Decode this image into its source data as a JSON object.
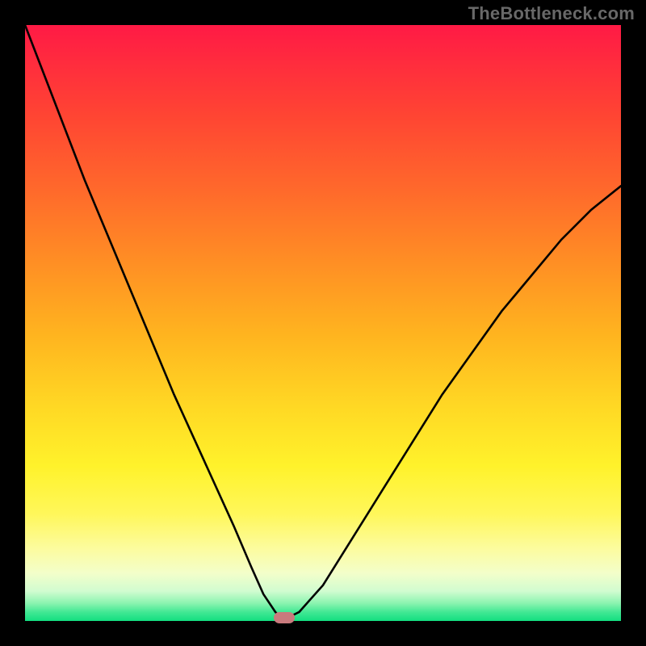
{
  "watermark": "TheBottleneck.com",
  "chart_data": {
    "type": "line",
    "title": "",
    "xlabel": "",
    "ylabel": "",
    "xlim": [
      0,
      100
    ],
    "ylim": [
      0,
      100
    ],
    "series": [
      {
        "name": "bottleneck-curve",
        "x": [
          0,
          5,
          10,
          15,
          20,
          25,
          30,
          35,
          38,
          40,
          42,
          43,
          44,
          46,
          50,
          55,
          60,
          65,
          70,
          75,
          80,
          85,
          90,
          95,
          100
        ],
        "y": [
          100,
          87,
          74,
          62,
          50,
          38,
          27,
          16,
          9,
          4.5,
          1.5,
          0.5,
          0.5,
          1.5,
          6,
          14,
          22,
          30,
          38,
          45,
          52,
          58,
          64,
          69,
          73
        ]
      }
    ],
    "marker": {
      "x": 43.5,
      "y": 0.5
    },
    "gradient": {
      "stops": [
        {
          "pos": 0,
          "color": "#ff1a45"
        },
        {
          "pos": 0.5,
          "color": "#ffb41f"
        },
        {
          "pos": 0.8,
          "color": "#fff75a"
        },
        {
          "pos": 1.0,
          "color": "#13de80"
        }
      ]
    }
  }
}
